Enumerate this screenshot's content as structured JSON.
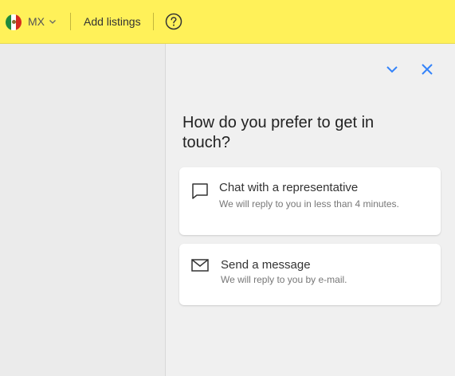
{
  "header": {
    "country_code": "MX",
    "add_listings_label": "Add listings"
  },
  "panel": {
    "title": "How do you prefer to get in touch?",
    "options": [
      {
        "title": "Chat with a representative",
        "description": "We will reply to you in less than 4 minutes.",
        "icon": "chat-icon"
      },
      {
        "title": "Send a message",
        "description": "We will reply to you by e-mail.",
        "icon": "envelope-icon"
      }
    ]
  },
  "colors": {
    "header_bg": "#fff159",
    "accent_blue": "#3483fa",
    "panel_bg": "#f0f0f0"
  }
}
